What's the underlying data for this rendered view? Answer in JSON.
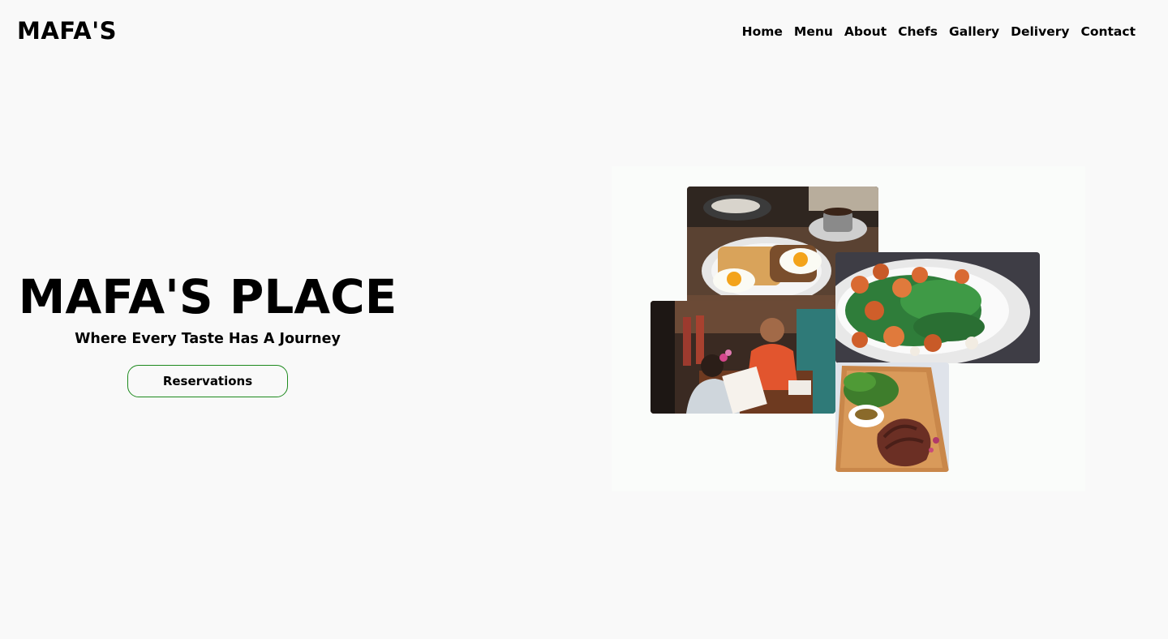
{
  "brand": {
    "logo_text": "MAFA'S"
  },
  "nav": {
    "items": [
      {
        "label": "Home"
      },
      {
        "label": "Menu"
      },
      {
        "label": "About"
      },
      {
        "label": "Chefs"
      },
      {
        "label": "Gallery"
      },
      {
        "label": "Delivery"
      },
      {
        "label": "Contact"
      }
    ]
  },
  "hero": {
    "title": "MAFA'S PLACE",
    "tagline": "Where Every Taste Has A Journey",
    "cta_label": "Reservations"
  },
  "colors": {
    "background": "#f9f9f9",
    "text": "#000000",
    "button_border": "#1e8a1e",
    "collage_panel": "#fafcfa"
  },
  "gallery": {
    "photos": [
      {
        "icon": "breakfast-photo"
      },
      {
        "icon": "salad-photo"
      },
      {
        "icon": "diners-photo"
      },
      {
        "icon": "steak-photo"
      }
    ]
  }
}
